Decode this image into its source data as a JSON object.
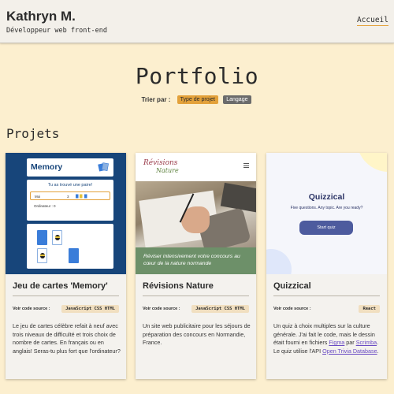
{
  "header": {
    "name": "Kathryn M.",
    "role": "Développeur web front-end",
    "nav_home": "Accueil"
  },
  "portfolio": {
    "title": "Portfolio",
    "sort_label": "Trier par :",
    "sort_options": [
      {
        "label": "Type de projet",
        "active": true
      },
      {
        "label": "Langage",
        "active": false
      }
    ]
  },
  "projects_heading": "Projets",
  "projects": [
    {
      "title": "Jeu de cartes 'Memory'",
      "source_label": "Voir code source :",
      "tags": "JavaScript CSS HTML",
      "description": "Le jeu de cartes célèbre refait à neuf avec trois niveaux de difficulté et trois choix de nombre de cartes. En français ou en anglais! Seras-tu plus fort que l'ordinateur?",
      "thumb": {
        "app_title": "Memory",
        "message": "Tu as trouvé une paire!",
        "player_label": "Moi",
        "player_score": "3",
        "computer_label": "Ordinateur :",
        "computer_score": "0"
      }
    },
    {
      "title": "Révisions Nature",
      "source_label": "Voir code source :",
      "tags": "JavaScript CSS HTML",
      "description": "Un site web publicitaire pour les séjours de préparation des concours en Normandie, France.",
      "thumb": {
        "logo_line1": "Révisions",
        "logo_line2": "Nature",
        "banner": "Réviser intensivement votre concours au cœur de la nature normande"
      }
    },
    {
      "title": "Quizzical",
      "source_label": "Voir code source :",
      "tags": "React",
      "description_parts": {
        "before": "Un quiz à choix multiples sur la culture générale. J'ai fait le code, mais le dessin était fourni en fichiers ",
        "link1": "Figma",
        "mid1": " par ",
        "link2": "Scrimba",
        "mid2": ". Le quiz utilise l'API ",
        "link3": "Open Trivia Database",
        "after": "."
      },
      "thumb": {
        "app_title": "Quizzical",
        "tagline": "Five questions. Any topic. Are you ready?",
        "button": "Start quiz"
      }
    }
  ],
  "colors": {
    "page_bg": "#fcefcf",
    "accent": "#e3a13a",
    "memory_blue": "#17457a",
    "nature_green": "#6d9069",
    "quiz_button": "#4d5b9e",
    "link": "#6a4bc4"
  }
}
